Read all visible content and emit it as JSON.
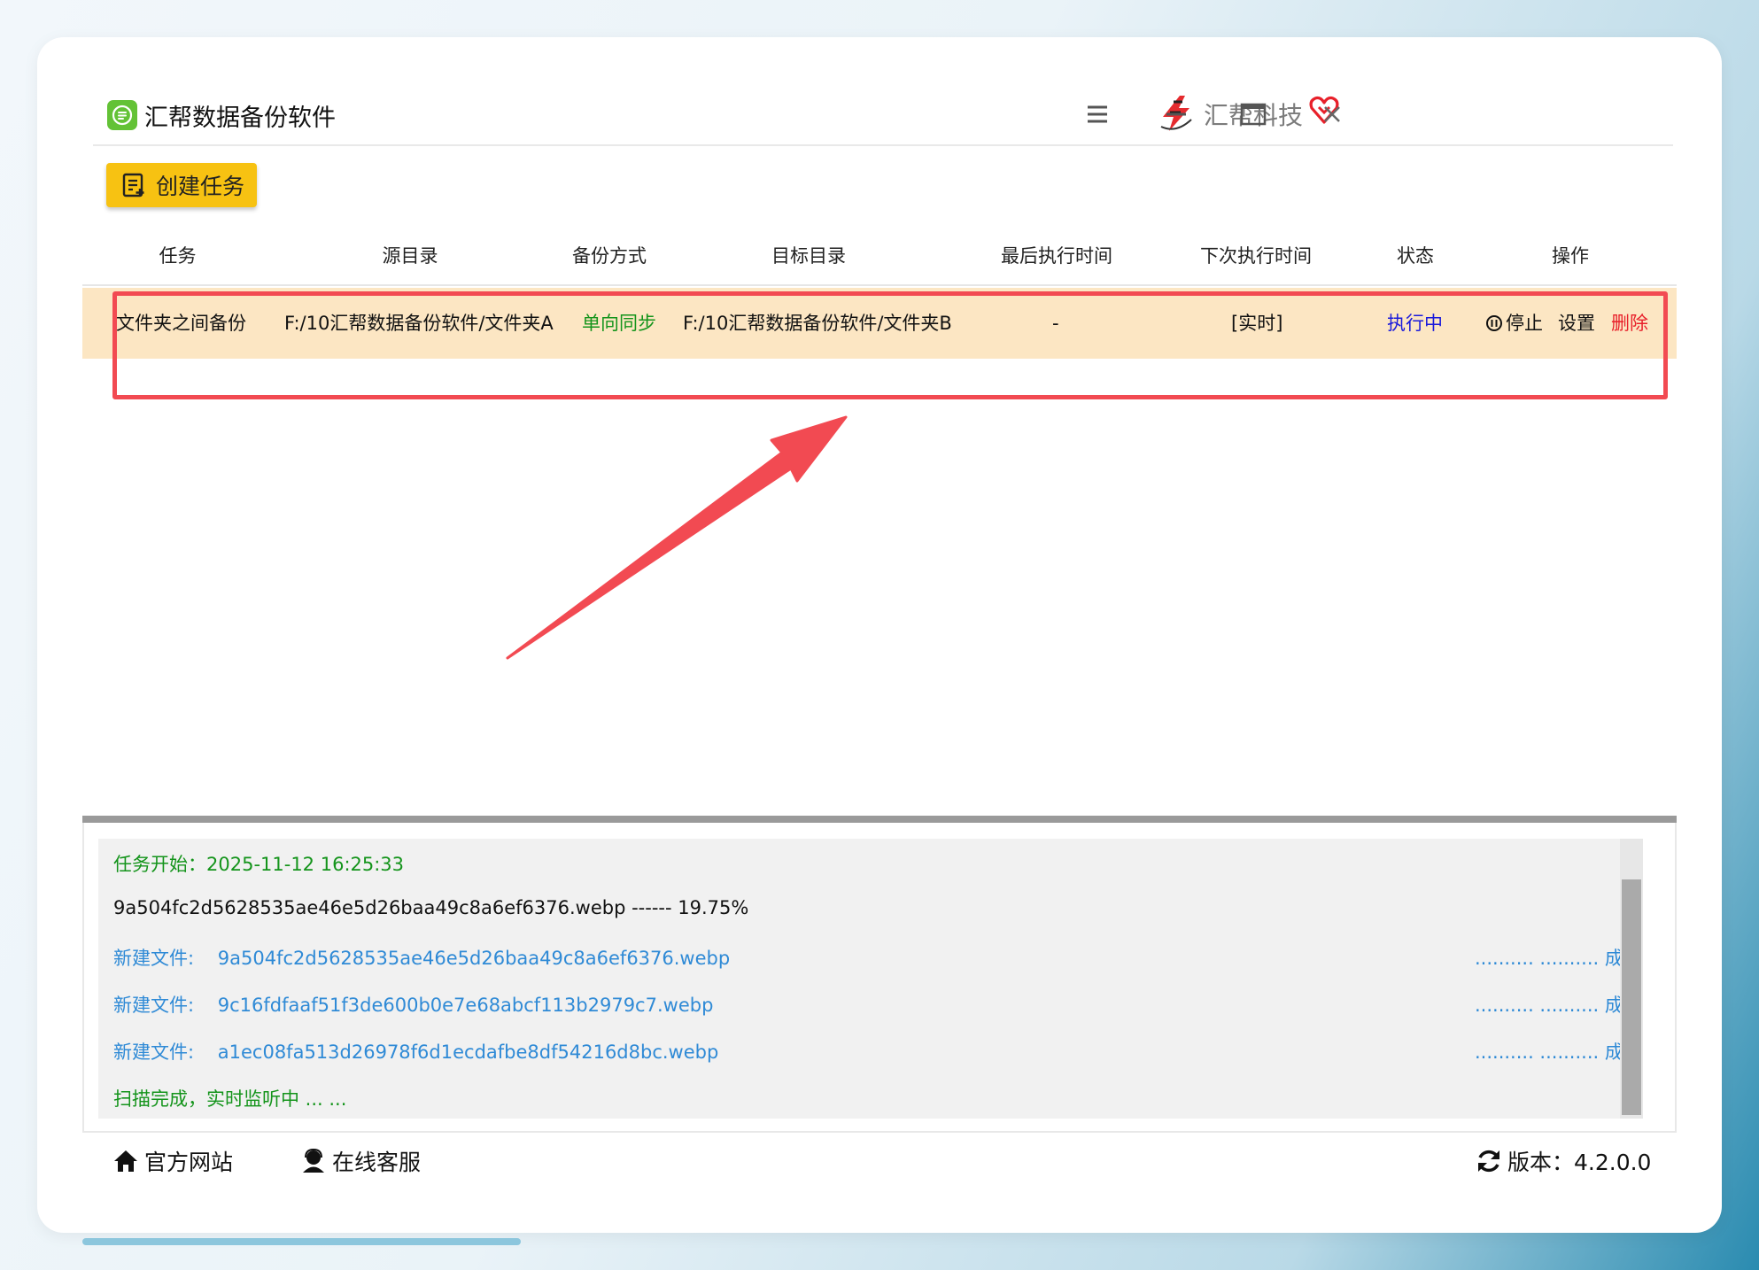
{
  "app": {
    "title": "汇帮数据备份软件",
    "brand": "汇帮科技"
  },
  "toolbar": {
    "create_label": "创建任务"
  },
  "table": {
    "headers": [
      "任务",
      "源目录",
      "备份方式",
      "目标目录",
      "最后执行时间",
      "下次执行时间",
      "状态",
      "操作"
    ],
    "rows": [
      {
        "task": "文件夹之间备份",
        "source": "F:/10汇帮数据备份软件/文件夹A",
        "mode": "单向同步",
        "target": "F:/10汇帮数据备份软件/文件夹B",
        "last_run": "-",
        "next_run": "[实时]",
        "status": "执行中",
        "actions": {
          "stop": "停止",
          "settings": "设置",
          "delete": "删除"
        }
      }
    ]
  },
  "log": {
    "start": "任务开始：2025-11-12 16:25:33",
    "progress": "9a504fc2d5628535ae46e5d26baa49c8a6ef6376.webp ------ 19.75%",
    "entries": [
      {
        "label": "新建文件:",
        "file": "9a504fc2d5628535ae46e5d26baa49c8a6ef6376.webp",
        "result": ".......... .......... 成功"
      },
      {
        "label": "新建文件:",
        "file": "9c16fdfaaf51f3de600b0e7e68abcf113b2979c7.webp",
        "result": ".......... .......... 成功"
      },
      {
        "label": "新建文件:",
        "file": "a1ec08fa513d26978f6d1ecdafbe8df54216d8bc.webp",
        "result": ".......... .......... 成功"
      }
    ],
    "done": "扫描完成，实时监听中 ... ..."
  },
  "footer": {
    "website": "官方网站",
    "support": "在线客服",
    "version": "版本：4.2.0.0"
  },
  "colors": {
    "accent_yellow": "#f7c212",
    "row_highlight": "#fce6c3",
    "annotation_red": "#f24a52",
    "status_blue": "#1a1adb",
    "mode_green": "#14941b",
    "delete_red": "#e8202a"
  }
}
